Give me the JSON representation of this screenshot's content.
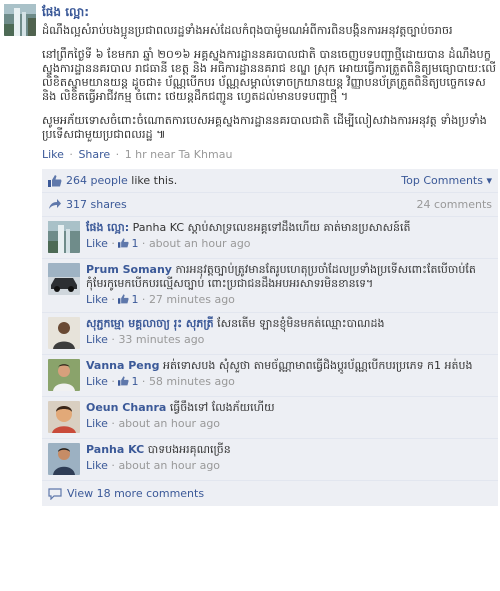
{
  "post": {
    "author": "ផែង ល្អោ:",
    "paragraphs": [
      "ដំណឹងល្អសំរាប់បងប្អូនប្រជាពលរដ្ឋទាំងអស់ដែលកំពុងបាម៉ូមណអំពីការពិនបង្កិនការអនុវត្តច្បាប់ចរាចរ",
      "នៅព្រឹកថ្ងៃទី ៦ ខែមករា ឆ្នាំ ២០១៦ អគ្គស្នងការដ្ឋាននគរបាលជាតិ បានចេញបទបញ្ជាថ្មីដោយបាន ដំណឹងបក្ខស្នងការដ្ឋាននគរបាល រាជធានី ខេត្ត និង អធិការដ្ឋាននគរាជ ខណ្ឌ ស្រុក អោយធ្វើការត្រួតពិនិត្យមធ្យោបាយ:លើលិខិតស្នាមយានយន្ត ដូចជា៖ ប័ណ្ណបើកបរ ប័ណ្ណសម្គាល់ទោចក្រយានយន្ត វិញ្ញាបនប័ត្រត្រួតពិនិត្យបច្ចេកទេស និង លិខិតធ្វើអាជីវកម្ម ចំពោះ ថេយន្តដឹកជញ្ជូន ហ្វេតដល់មានបទបញ្ជាថ្មី ។",
      "សូមអភ័យទោសចំពោះចំណោតការបេសអគ្គស្នងការដ្ឋាននគរបាលជាតិ ដើម្បីលៀសវាងការអនុវត្ត ទាំងប្រទាំងប្រទើសជាមួយប្រជាពលរដ្ឋ ៕"
    ],
    "actions": {
      "like": "Like",
      "share": "Share",
      "time": "1 hr near Ta Khmau"
    }
  },
  "ufi": {
    "likes_count": "264 people",
    "likes_suffix": " like this.",
    "top_comments": "Top Comments ▾",
    "shares": "317 shares",
    "comments_count": "24 comments",
    "view_more": "View 18 more comments"
  },
  "comments": [
    {
      "name": "ផែង ល្អោ:",
      "text": "Panha KC ស្ដាប់សាទ្រលេខអគ្គទៅដឹងហើយ គាត់មានប្រសាសន៍តើ",
      "like_label": "Like",
      "like_count": "1",
      "time": "about an hour ago"
    },
    {
      "name": "Prum Somany",
      "text": "ការអនុវត្តច្បាប់ត្រូវមានតែរូបហេតុប្រចាំដែលប្រទាំងប្រទើសពោះតែបើចាប់តែកុំមែរកូមេកបើកបរល្មើសច្បាប់ ពោះប្រជាជនដឹងអបអរសាទរមិនខានទេ។",
      "like_label": "Like",
      "like_count": "1",
      "time": "27 minutes ago"
    },
    {
      "name": "សុភ្ជកម្មោ មគ្គលាចា្យ រុះ សុភត្រី",
      "text": "សែនតើម ឡានខ្ញុំមិនមកត់ឈ្មោះបាណដង",
      "like_label": "Like",
      "like_count": "",
      "time": "33 minutes ago"
    },
    {
      "name": "Vanna Peng",
      "text": "អត់ទោសបង សុំសួថា តាមច័ណ្ណាមាពធ្វើជិងប្តូរប័ណ្ណបើកបរប្រភេទ ក1 អត់បង",
      "like_label": "Like",
      "like_count": "1",
      "time": "58 minutes ago"
    },
    {
      "name": "Oeun Chanra",
      "text": "ធ្វើចឹងទៅ លែងភ័យហើយ",
      "like_label": "Like",
      "like_count": "",
      "time": "about an hour ago"
    },
    {
      "name": "Panha KC",
      "text": "បាទបងអរគុណច្រើន",
      "like_label": "Like",
      "like_count": "",
      "time": "about an hour ago"
    }
  ],
  "colors": {
    "link": "#3b5998",
    "ufi_bg": "#edeff4",
    "meta": "#999999"
  }
}
